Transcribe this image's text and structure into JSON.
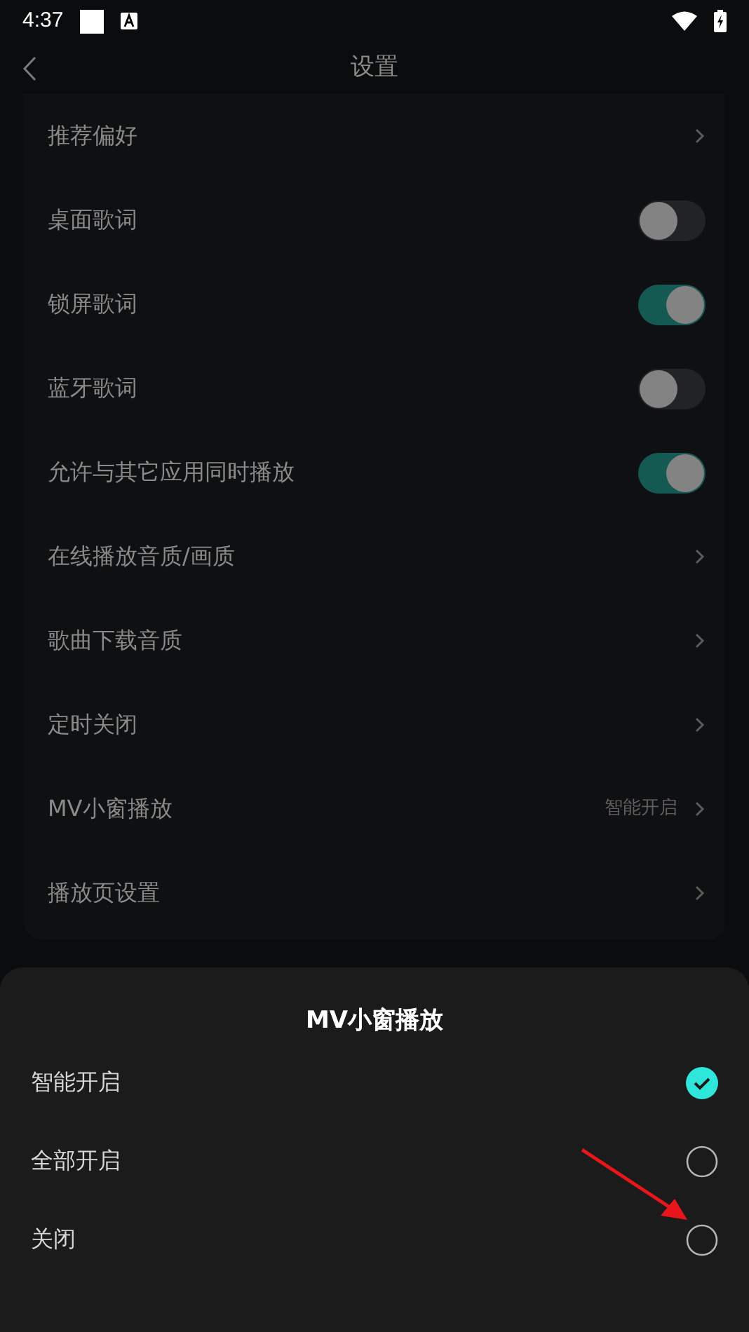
{
  "status_bar": {
    "time": "4:37"
  },
  "header": {
    "title": "设置"
  },
  "settings": [
    {
      "kind": "link",
      "label": "推荐偏好"
    },
    {
      "kind": "toggle",
      "label": "桌面歌词",
      "on": false
    },
    {
      "kind": "toggle",
      "label": "锁屏歌词",
      "on": true
    },
    {
      "kind": "toggle",
      "label": "蓝牙歌词",
      "on": false
    },
    {
      "kind": "toggle",
      "label": "允许与其它应用同时播放",
      "on": true
    },
    {
      "kind": "link",
      "label": "在线播放音质/画质"
    },
    {
      "kind": "link",
      "label": "歌曲下载音质"
    },
    {
      "kind": "link",
      "label": "定时关闭"
    },
    {
      "kind": "link",
      "label": "MV小窗播放",
      "value": "智能开启"
    },
    {
      "kind": "link",
      "label": "播放页设置"
    }
  ],
  "sheet": {
    "title": "MV小窗播放",
    "options": [
      {
        "label": "智能开启",
        "selected": true
      },
      {
        "label": "全部开启",
        "selected": false
      },
      {
        "label": "关闭",
        "selected": false
      }
    ]
  }
}
